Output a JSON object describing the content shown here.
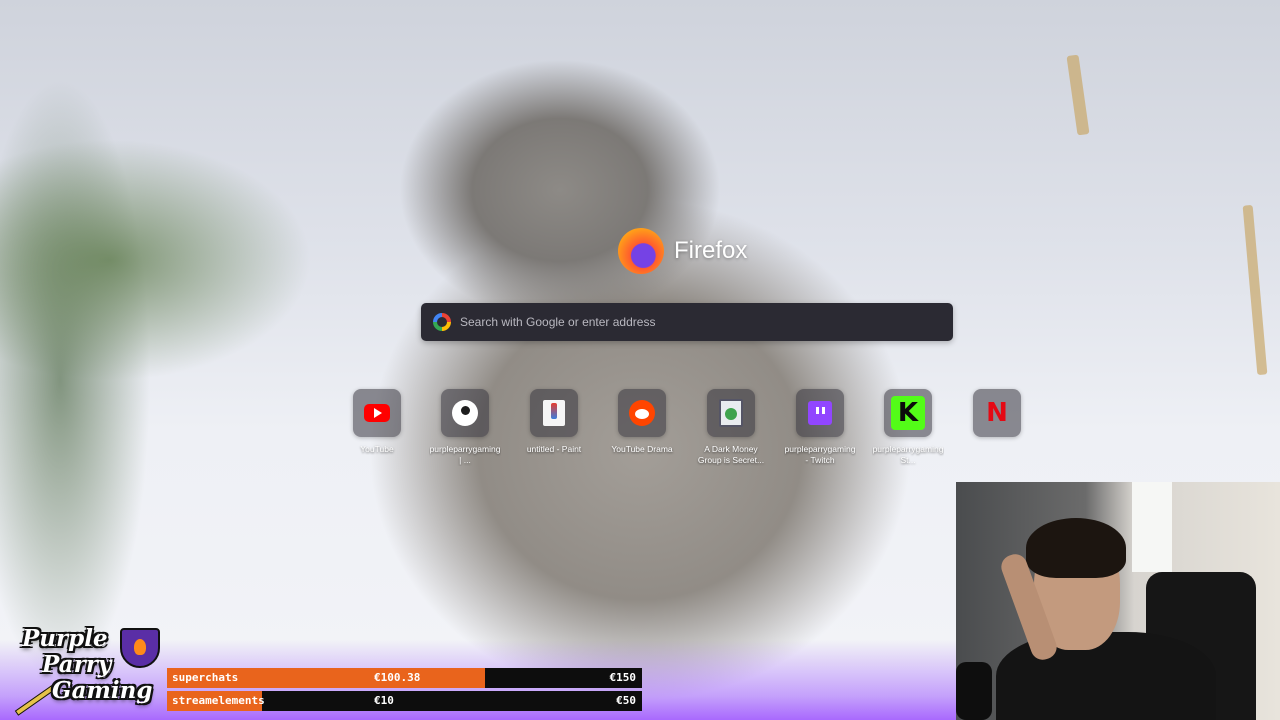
{
  "browser": {
    "logo_text": "Firefox",
    "search": {
      "placeholder": "Search with Google or enter address"
    },
    "top_sites": [
      {
        "label": "YouTube",
        "icon": "youtube-icon"
      },
      {
        "label": "purpleparrygaming | ...",
        "icon": "patreon-icon"
      },
      {
        "label": "untitled - Paint",
        "icon": "paint-icon"
      },
      {
        "label": "YouTube Drama",
        "icon": "reddit-icon"
      },
      {
        "label": "A Dark Money Group is Secret...",
        "icon": "document-icon"
      },
      {
        "label": "purpleparrygaming - Twitch",
        "icon": "twitch-icon"
      },
      {
        "label": "purpleparrygaming St...",
        "icon": "kick-icon"
      },
      {
        "label": "",
        "icon": "netflix-icon"
      }
    ]
  },
  "overlay": {
    "brand_lines": [
      "Purple",
      "Parry",
      "Gaming"
    ],
    "goals": [
      {
        "title": "superchats",
        "current": "€100.38",
        "target": "€150",
        "progress": 0.669,
        "color": "#e9641c"
      },
      {
        "title": "streamelements",
        "current": "€10",
        "target": "€50",
        "progress": 0.2,
        "color": "#e9641c"
      }
    ]
  },
  "colors": {
    "search_bg": "#2b2a33",
    "tile_bg": "#34333c",
    "goal_fill": "#e9641c",
    "overlay_purple": "#8c3cff"
  }
}
